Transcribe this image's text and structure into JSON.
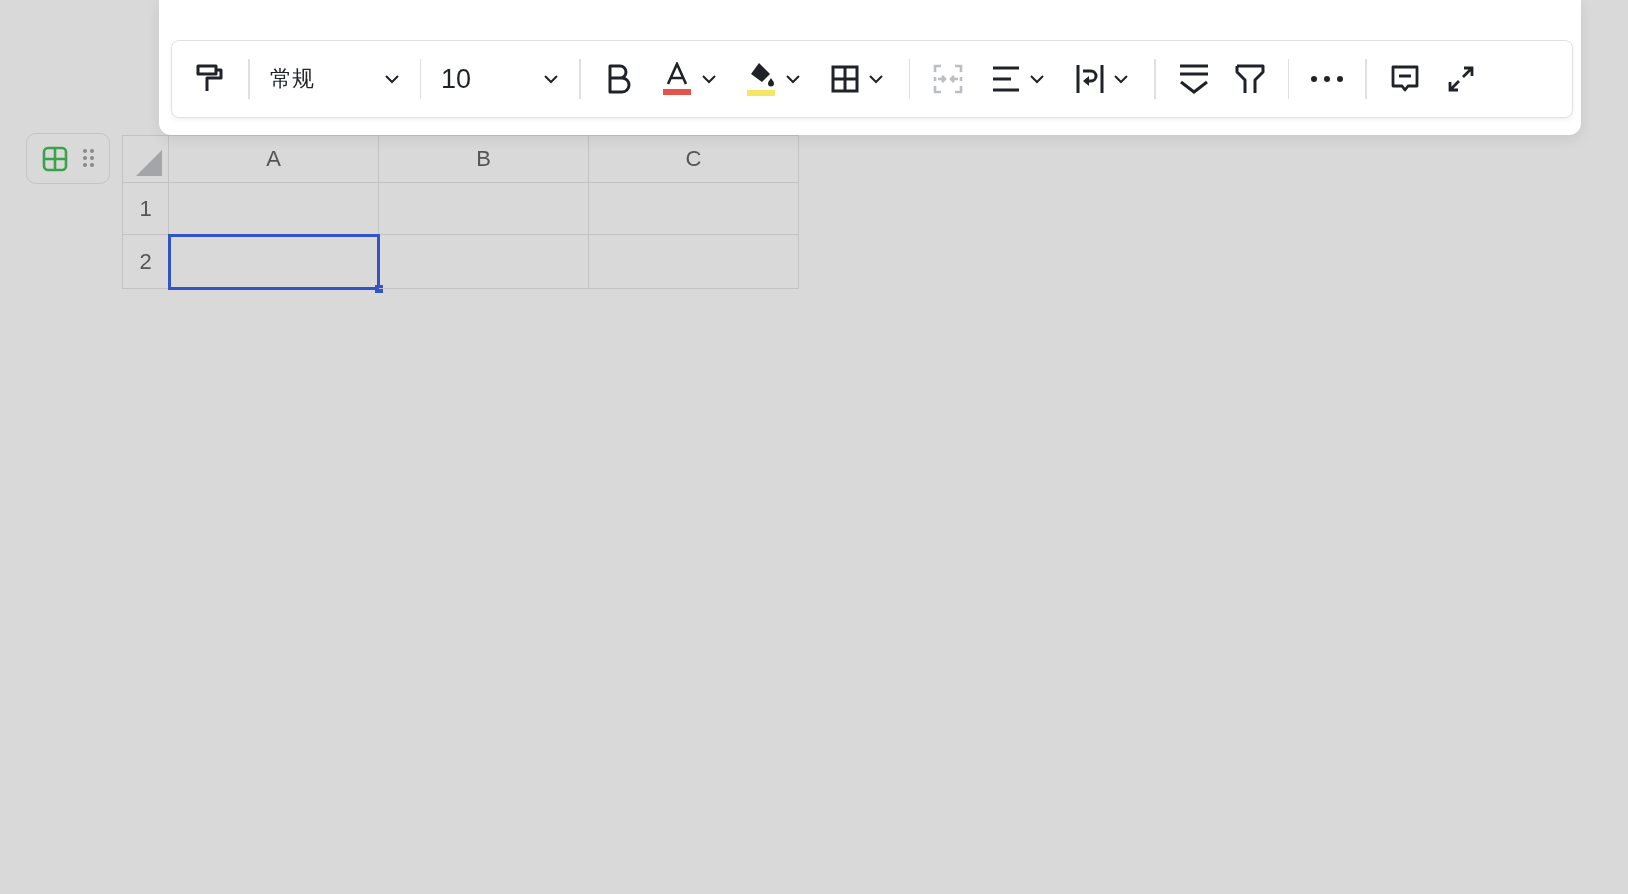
{
  "toolbar": {
    "number_format": {
      "value": "常规"
    },
    "font_size": {
      "value": "10"
    },
    "text_color": {
      "color": "#e5534b"
    },
    "fill_color": {
      "color": "#f5e663"
    },
    "merge": {
      "disabled": true
    }
  },
  "table": {
    "columns": [
      "A",
      "B",
      "C"
    ],
    "rows": [
      {
        "header": "1",
        "cells": [
          {
            "selected": false
          },
          {
            "selected": false
          },
          {
            "selected": false
          }
        ]
      },
      {
        "header": "2",
        "cells": [
          {
            "selected": true
          },
          {
            "selected": false
          },
          {
            "selected": false
          }
        ]
      }
    ]
  }
}
